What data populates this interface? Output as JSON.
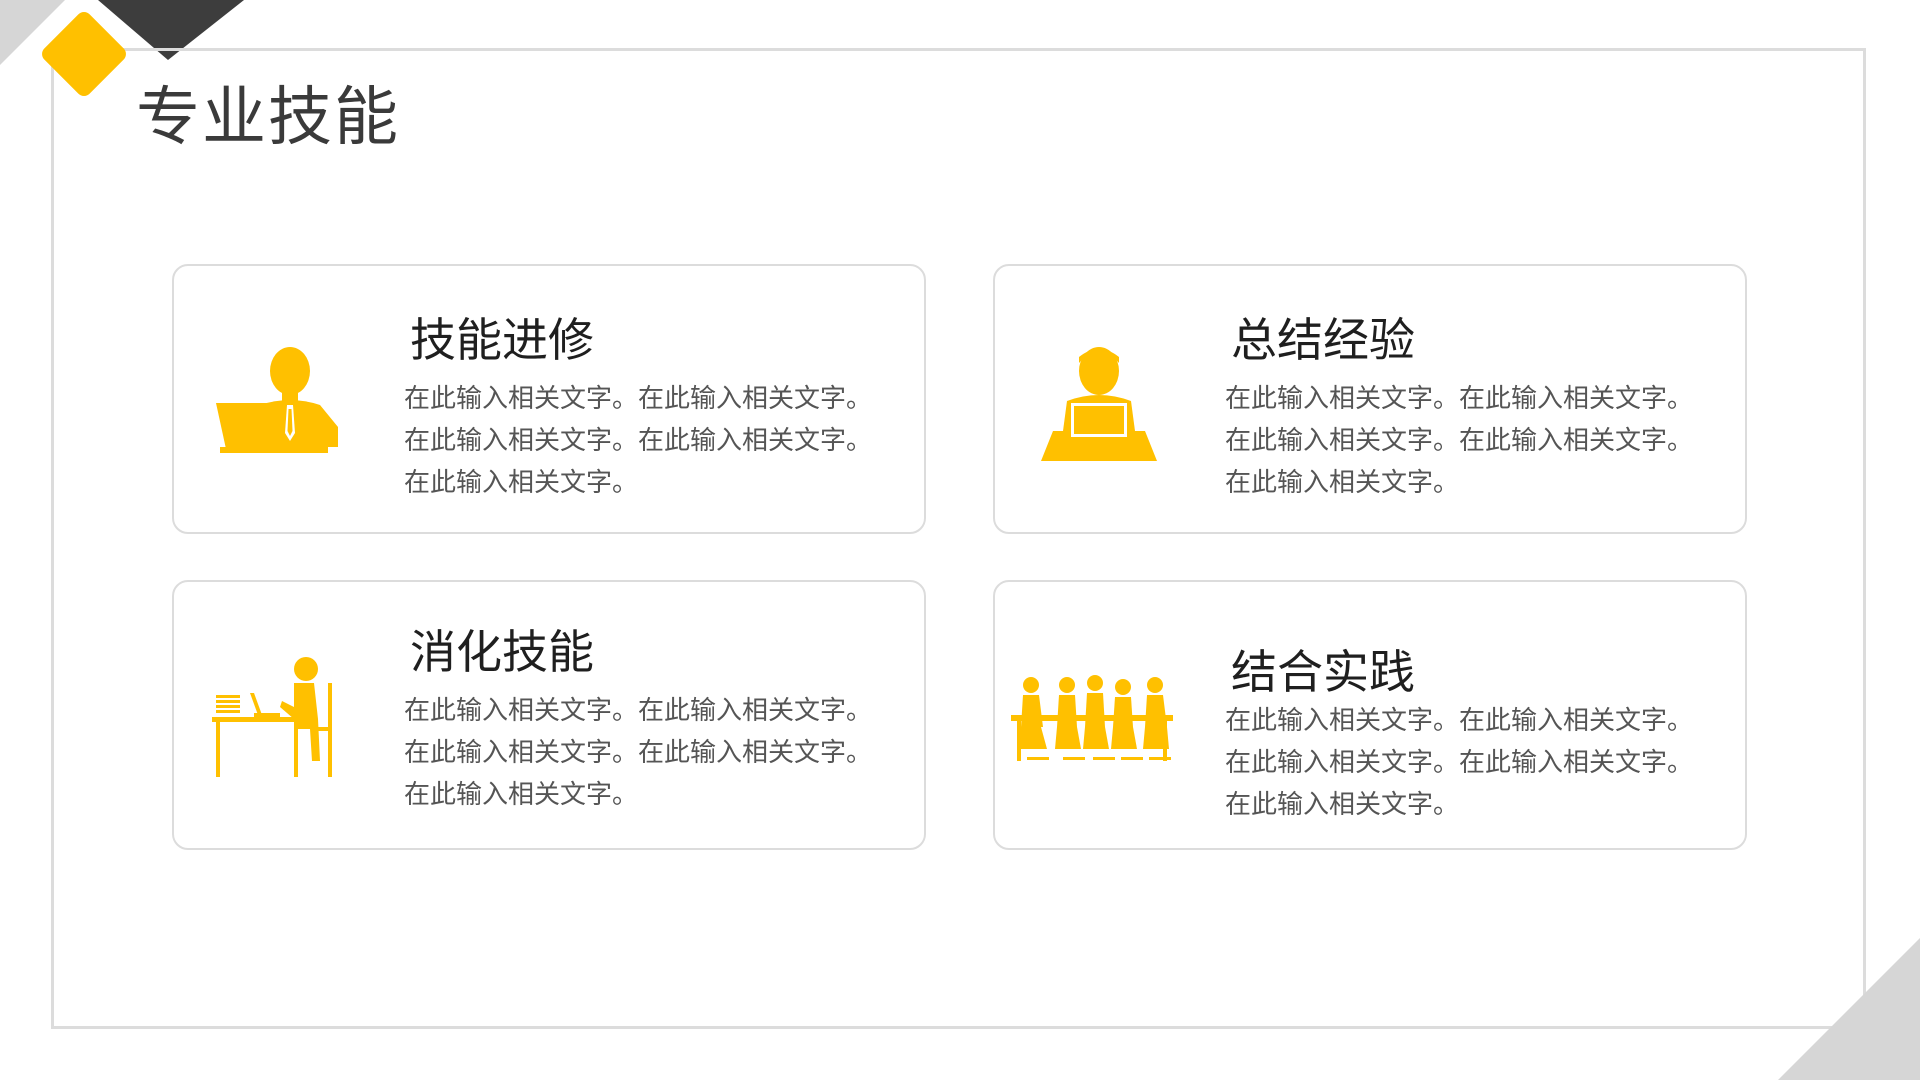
{
  "page": {
    "title": "专业技能"
  },
  "colors": {
    "accent": "#ffc000",
    "frame": "#dcdcdc",
    "dark_corner": "#3d3d3d",
    "title_text": "#3a3a3a",
    "body_text": "#555555"
  },
  "cards": [
    {
      "icon": "person-at-laptop-icon",
      "title": "技能进修",
      "lines": [
        "在此输入相关文字。在此输入相关文字。",
        "在此输入相关文字。在此输入相关文字。",
        "在此输入相关文字。"
      ]
    },
    {
      "icon": "man-at-desk-icon",
      "title": "总结经验",
      "lines": [
        "在此输入相关文字。在此输入相关文字。",
        "在此输入相关文字。在此输入相关文字。",
        "在此输入相关文字。"
      ]
    },
    {
      "icon": "person-working-desk-icon",
      "title": "消化技能",
      "lines": [
        "在此输入相关文字。在此输入相关文字。",
        "在此输入相关文字。在此输入相关文字。",
        "在此输入相关文字。"
      ]
    },
    {
      "icon": "team-meeting-icon",
      "title": "结合实践",
      "lines": [
        "在此输入相关文字。在此输入相关文字。",
        "在此输入相关文字。在此输入相关文字。",
        "在此输入相关文字。"
      ]
    }
  ]
}
